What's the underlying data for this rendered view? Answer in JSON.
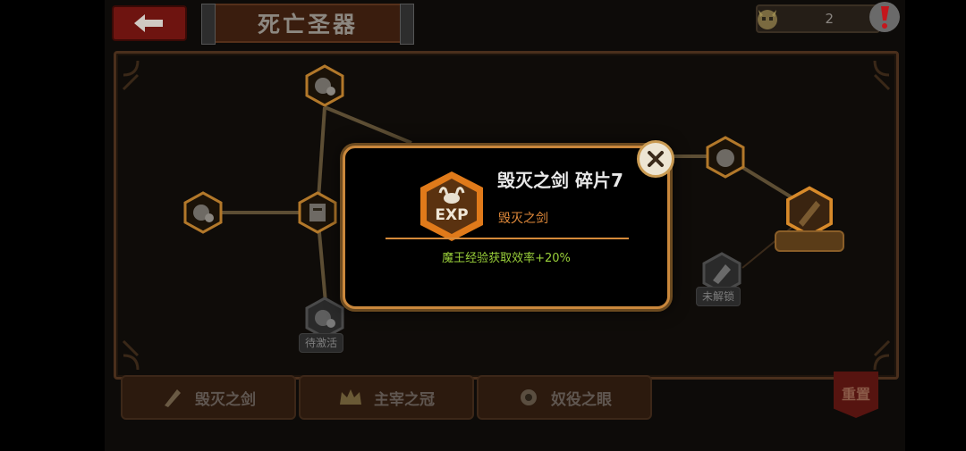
{
  "header": {
    "back_icon": "left-arrow-icon",
    "title": "死亡圣器",
    "counter_icon": "demon-skull-icon",
    "counter_value": "2",
    "alert_icon": "exclamation-icon"
  },
  "board": {
    "nodes": [
      {
        "icon": "demon-lock-icon",
        "state": "active"
      },
      {
        "icon": "demon-lock-icon",
        "state": "active"
      },
      {
        "icon": "scroll-icon",
        "state": "active"
      },
      {
        "icon": "demon-lock-icon",
        "state": "active"
      },
      {
        "icon": "demon-lock-icon",
        "state": "pending",
        "label": "待激活"
      },
      {
        "icon": "sword-icon",
        "state": "highlight"
      },
      {
        "icon": "wing-icon",
        "state": "locked",
        "label": "未解锁"
      }
    ]
  },
  "tabs": [
    {
      "label": "毁灭之剑",
      "icon": "sword-icon"
    },
    {
      "label": "主宰之冠",
      "icon": "crown-icon"
    },
    {
      "label": "奴役之眼",
      "icon": "eye-icon"
    }
  ],
  "reset_label": "重置",
  "popup": {
    "badge_text": "EXP",
    "title": "毁灭之剑 碎片7",
    "subtitle": "毁灭之剑",
    "effect": "魔王经验获取效率+20%",
    "close_icon": "close-icon"
  },
  "colors": {
    "accent_orange": "#e0893a",
    "effect_green": "#9ad03a",
    "popup_border": "#c9873c"
  }
}
